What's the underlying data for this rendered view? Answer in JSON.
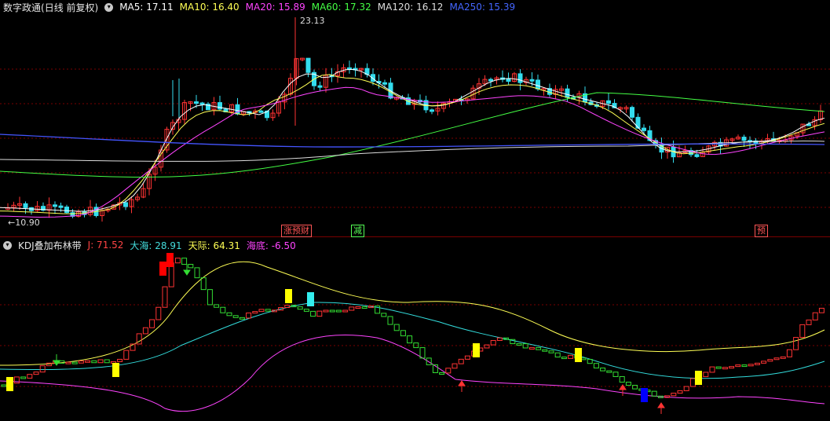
{
  "main_header": {
    "title": "数字政通",
    "mode": "(日线 前复权)",
    "indicators": [
      {
        "label": "MA5: 17.11",
        "color": "#ffffff"
      },
      {
        "label": "MA10: 16.40",
        "color": "#ffff55"
      },
      {
        "label": "MA20: 15.89",
        "color": "#ff44ff"
      },
      {
        "label": "MA60: 17.32",
        "color": "#44ff44"
      },
      {
        "label": "MA120: 16.12",
        "color": "#dddddd"
      },
      {
        "label": "MA250: 15.39",
        "color": "#4444ff"
      }
    ]
  },
  "annotations": {
    "high_label": "23.13",
    "low_label": "10.90"
  },
  "event_markers": [
    {
      "text": "涨预财",
      "color": "#ff5555"
    },
    {
      "text": "减",
      "color": "#55ff55"
    },
    {
      "text": "预",
      "color": "#ff5555"
    }
  ],
  "sub_header": {
    "title": "KDJ叠加布林带",
    "indicators": [
      {
        "label": "J: 71.52",
        "color": "#ff4444"
      },
      {
        "label": "大海: 28.91",
        "color": "#44dddd"
      },
      {
        "label": "天际: 64.31",
        "color": "#ffff55"
      },
      {
        "label": "海底: -6.50",
        "color": "#ff44ff"
      }
    ]
  },
  "colors": {
    "up": "#ff3333",
    "down": "#33ddee",
    "grid": "#7a0000",
    "bg": "#000000"
  }
}
